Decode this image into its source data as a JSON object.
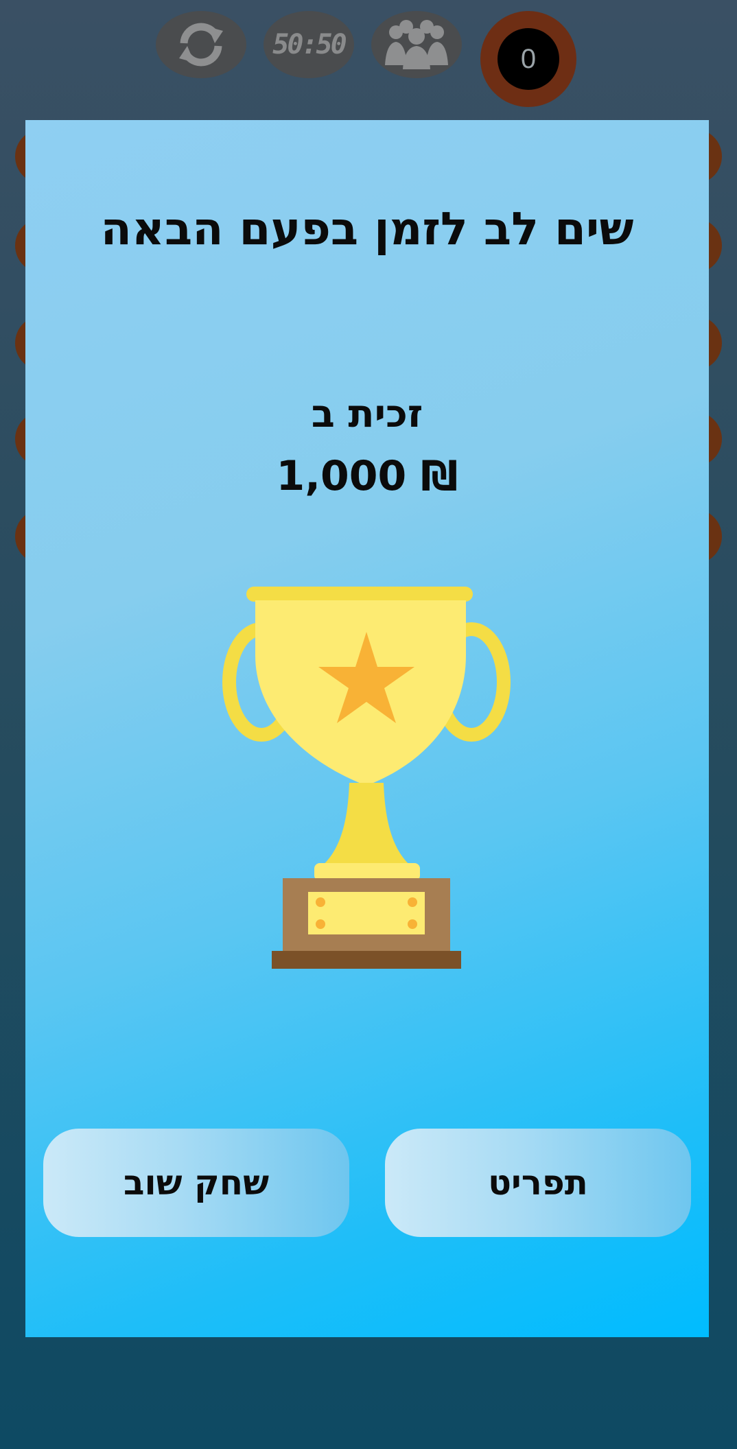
{
  "game": {
    "lifelines": {
      "fifty_fifty_label": "50:50"
    },
    "score": "0"
  },
  "modal": {
    "title": "שים לב לזמן בפעם הבאה",
    "win_label": "זכית ב",
    "win_amount": "₪ 1,000",
    "buttons": {
      "menu": "תפריט",
      "replay": "שחק שוב"
    }
  },
  "colors": {
    "trophy_gold": "#f4dd45",
    "trophy_light": "#fdeb72",
    "star": "#f8b236",
    "base_brown": "#a77e52",
    "base_dark": "#7b5128"
  }
}
